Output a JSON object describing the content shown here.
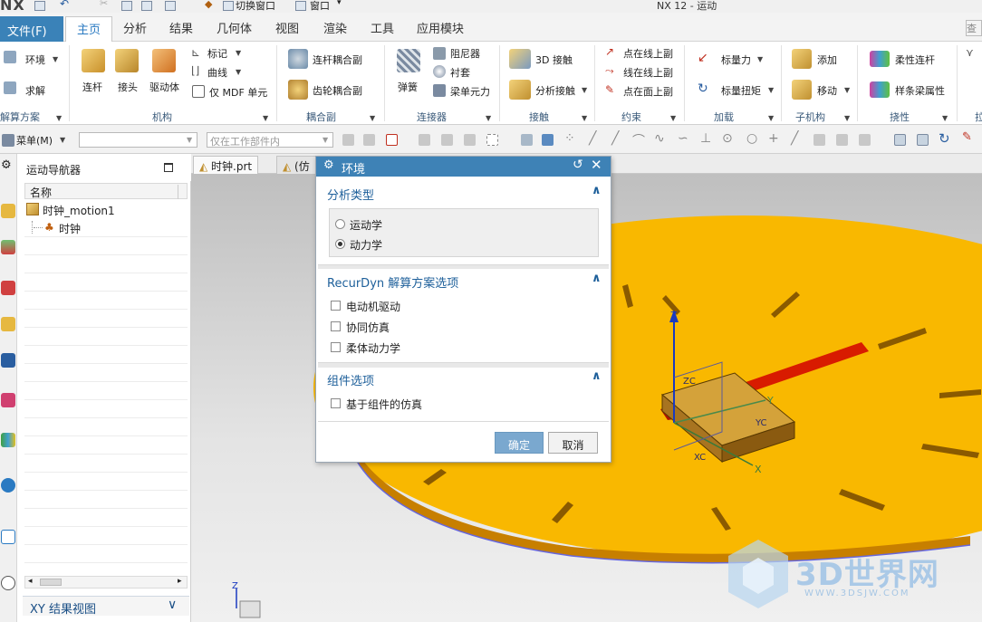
{
  "titlebar": {
    "logo": "NX",
    "switch_window": "切换窗口",
    "window_menu": "窗口",
    "title": "NX 12 - 运动"
  },
  "tabs": {
    "file": "文件(F)",
    "items": [
      "主页",
      "分析",
      "结果",
      "几何体",
      "视图",
      "渲染",
      "工具",
      "应用模块"
    ],
    "search_placeholder": "查"
  },
  "ribbon": {
    "environment": "环境",
    "solve": "求解",
    "link": "连杆",
    "joint": "接头",
    "driver": "驱动体",
    "marker": "标记",
    "curve": "曲线",
    "mdf_only": "仅 MDF 单元",
    "link_coupler": "连杆耦合副",
    "gear_coupler": "齿轮耦合副",
    "spring": "弹簧",
    "damper": "阻尼器",
    "bushing": "衬套",
    "beam_force": "梁单元力",
    "contact_3d": "3D 接触",
    "analysis_contact": "分析接触",
    "point_on_curve": "点在线上副",
    "curve_on_curve": "线在线上副",
    "point_on_surface": "点在面上副",
    "scalar_force": "标量力",
    "scalar_torque": "标量扭矩",
    "add": "添加",
    "move": "移动",
    "flex_link": "柔性连杆",
    "spline_beam": "样条梁属性",
    "groups": [
      "解算方案",
      "机构",
      "耦合副",
      "连接器",
      "接触",
      "约束",
      "加载",
      "子机构",
      "挠性",
      "拉"
    ]
  },
  "cmdbar": {
    "menu": "菜单(M)",
    "filter_value": "",
    "scope": "仅在工作部件内"
  },
  "navigator": {
    "title": "运动导航器",
    "col_name": "名称",
    "tree": [
      {
        "label": "时钟_motion1"
      },
      {
        "label": "时钟"
      }
    ],
    "footer": "XY 结果视图"
  },
  "graphics_tabs": [
    {
      "label": "时钟.prt"
    },
    {
      "label": "(仿"
    }
  ],
  "viewport": {
    "axis_z": "Z",
    "axis_y": "Y",
    "axis_x": "X",
    "axis_xc": "XC",
    "axis_yc": "YC",
    "axis_zc": "ZC"
  },
  "dialog": {
    "title": "环境",
    "section1": {
      "title": "分析类型",
      "options": [
        {
          "label": "运动学",
          "selected": false
        },
        {
          "label": "动力学",
          "selected": true
        }
      ]
    },
    "section2": {
      "title": "RecurDyn 解算方案选项",
      "options": [
        {
          "label": "电动机驱动",
          "checked": false
        },
        {
          "label": "协同仿真",
          "checked": false
        },
        {
          "label": "柔体动力学",
          "checked": false
        }
      ]
    },
    "section3": {
      "title": "组件选项",
      "options": [
        {
          "label": "基于组件的仿真",
          "checked": false
        }
      ]
    },
    "ok": "确定",
    "cancel": "取消"
  },
  "watermark": {
    "brand": "3D世界网",
    "url": "WWW.3DSJW.COM"
  },
  "colors": {
    "accent": "#3e82b6",
    "dial_face": "#f9b800",
    "hand": "#d81b00"
  }
}
